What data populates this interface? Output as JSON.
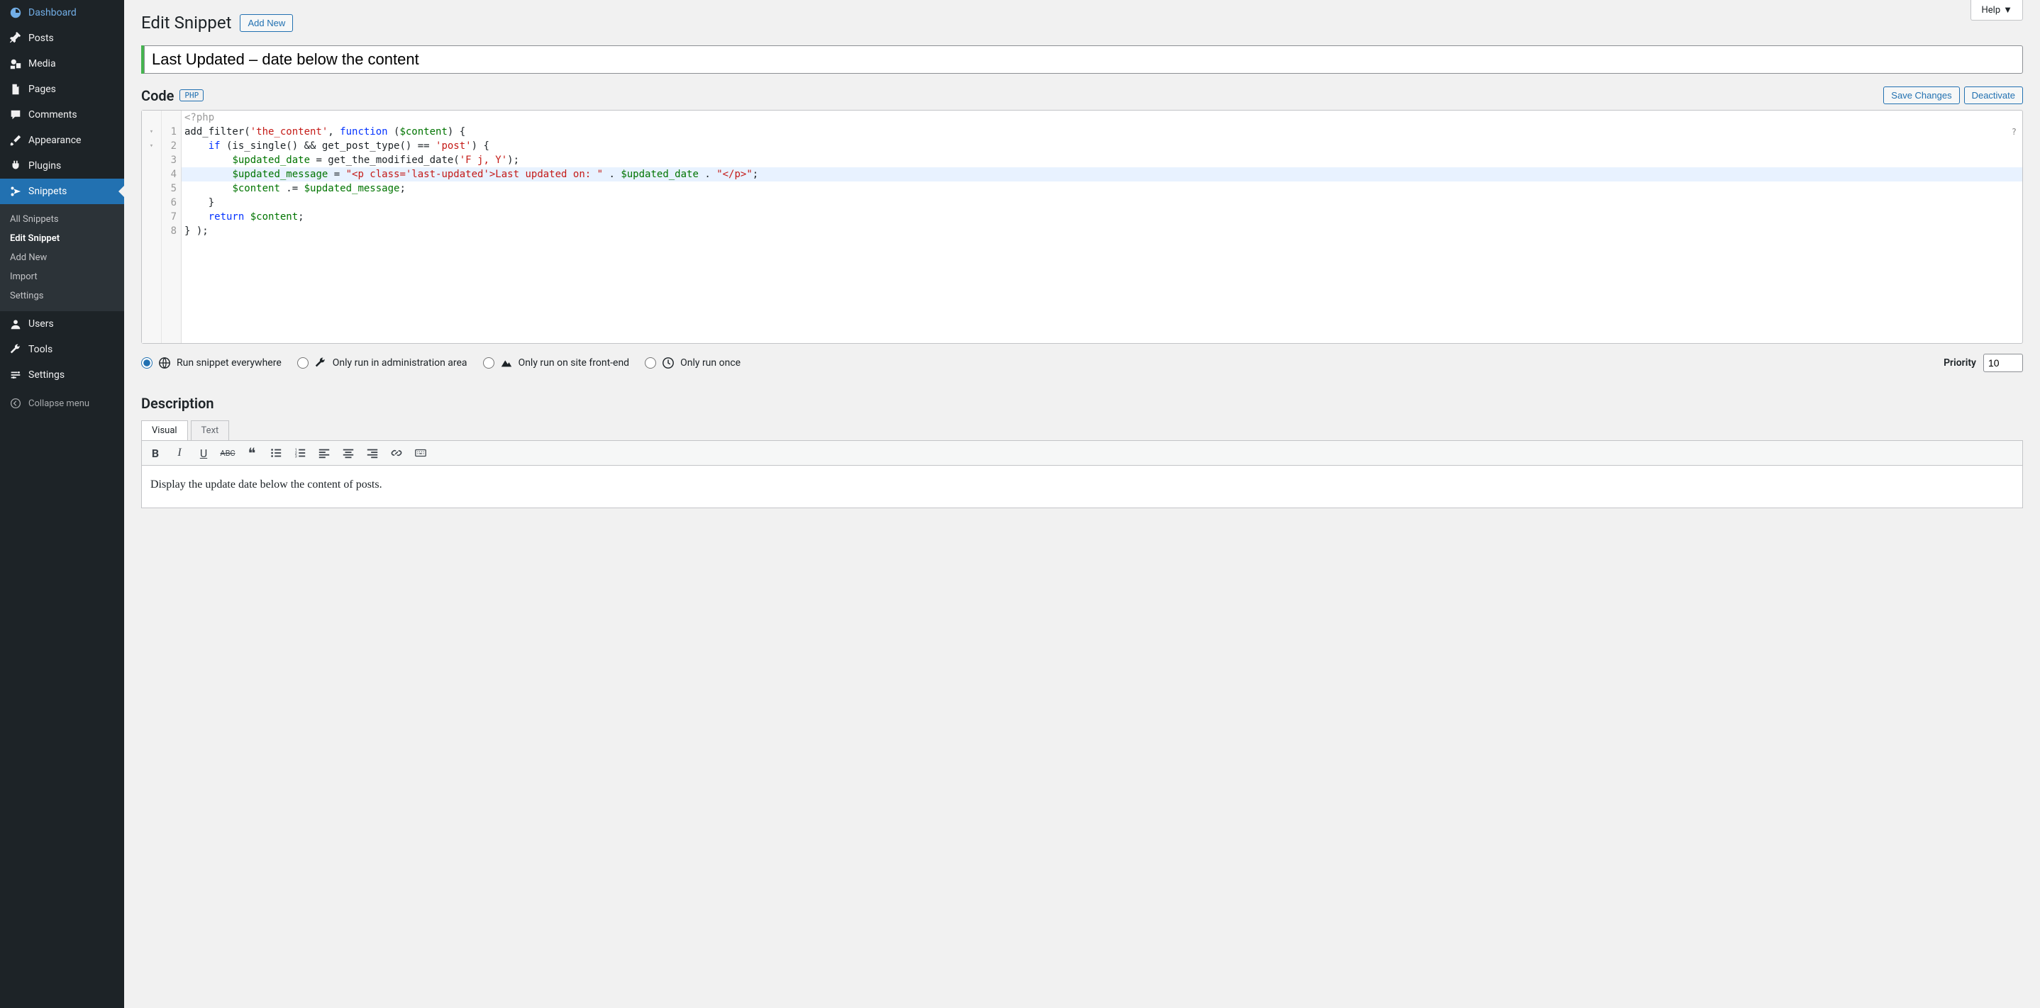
{
  "help_label": "Help",
  "page_title": "Edit Snippet",
  "add_new_label": "Add New",
  "snippet_title": "Last Updated – date below the content",
  "code_section": {
    "heading": "Code",
    "lang_badge": "PHP",
    "save_label": "Save Changes",
    "deactivate_label": "Deactivate",
    "php_open": "<?php"
  },
  "code_lines": [
    "add_filter('the_content', function ($content) {",
    "    if (is_single() && get_post_type() == 'post') {",
    "        $updated_date = get_the_modified_date('F j, Y');",
    "        $updated_message = \"<p class='last-updated'>Last updated on: \" . $updated_date . \"</p>\";",
    "        $content .= $updated_message;",
    "    }",
    "    return $content;",
    "} );"
  ],
  "scope": {
    "everywhere": "Run snippet everywhere",
    "admin": "Only run in administration area",
    "frontend": "Only run on site front-end",
    "once": "Only run once",
    "selected": "everywhere"
  },
  "priority": {
    "label": "Priority",
    "value": "10"
  },
  "description": {
    "heading": "Description",
    "tab_visual": "Visual",
    "tab_text": "Text",
    "body": "Display the update date below the content of posts."
  },
  "sidebar": {
    "dashboard": "Dashboard",
    "posts": "Posts",
    "media": "Media",
    "pages": "Pages",
    "comments": "Comments",
    "appearance": "Appearance",
    "plugins": "Plugins",
    "snippets": "Snippets",
    "users": "Users",
    "tools": "Tools",
    "settings": "Settings",
    "collapse": "Collapse menu",
    "sub_all": "All Snippets",
    "sub_edit": "Edit Snippet",
    "sub_add": "Add New",
    "sub_import": "Import",
    "sub_settings": "Settings"
  }
}
